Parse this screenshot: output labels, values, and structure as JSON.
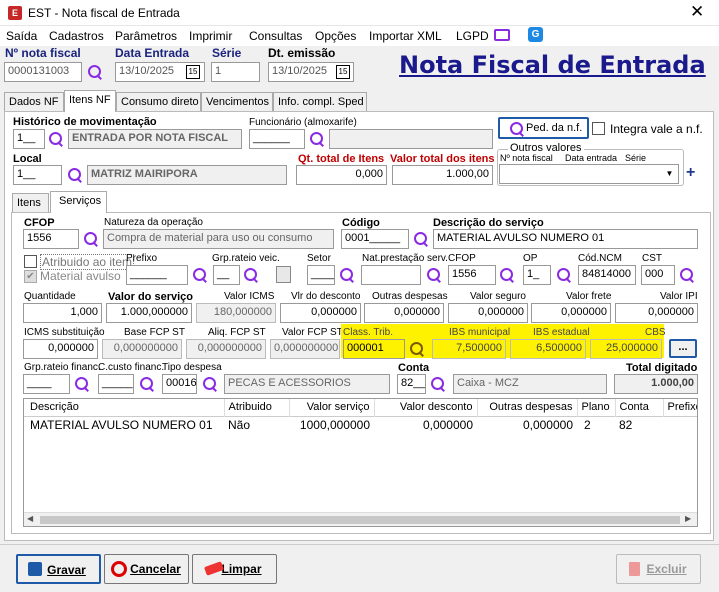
{
  "window": {
    "title": "EST - Nota fiscal de Entrada",
    "close": "✕"
  },
  "menu": [
    "Saída",
    "Cadastros",
    "Parâmetros",
    "Imprimir",
    "Consultas",
    "Opções",
    "Importar XML",
    "LGPD"
  ],
  "header": {
    "nota_label": "Nº nota fiscal",
    "nota_value": "0000131003",
    "data_entrada_label": "Data Entrada",
    "data_entrada_value": "13/10/2025",
    "serie_label": "Série",
    "serie_value": "1",
    "dt_emissao_label": "Dt. emissão",
    "dt_emissao_value": "13/10/2025",
    "calendar_icon": "15",
    "big_title": "Nota Fiscal de Entrada"
  },
  "tabs": [
    "Dados NF",
    "Itens NF",
    "Consumo direto",
    "Vencimentos",
    "Info. compl. Sped"
  ],
  "itens_nf": {
    "historico_label": "Histórico de movimentação",
    "historico_code": "1__",
    "historico_desc": "ENTRADA POR NOTA FISCAL",
    "funcionario_label": "Funcionário (almoxarife)",
    "funcionario_value": "______",
    "ped_button": "Ped. da n.f.",
    "integra_label": "Integra vale a n.f.",
    "local_label": "Local",
    "local_code": "1__",
    "local_desc": "MATRIZ MAIRIPORA",
    "qt_total_label": "Qt. total de Itens",
    "qt_total_value": "0,000",
    "valor_total_label": "Valor total dos itens",
    "valor_total_value": "1.000,00",
    "outros_label": "Outros valores",
    "outros_cols": [
      "Nº nota fiscal",
      "Data entrada",
      "Série"
    ],
    "plus": "+"
  },
  "subtabs": [
    "Itens",
    "Serviços"
  ],
  "servicos": {
    "cfop_label": "CFOP",
    "cfop_value": "1556",
    "natureza_label": "Natureza da operação",
    "natureza_value": "Compra de material para uso ou consumo",
    "codigo_label": "Código",
    "codigo_value": "0001_____",
    "descricao_label": "Descrição do serviço",
    "descricao_value": "MATERIAL AVULSO NUMERO 01",
    "atribuido_label": "Atribuido ao item",
    "material_avulso_label": "Material avulso",
    "prefixo_label": "Prefixo",
    "prefixo_value": "______",
    "grp_rateio_label": "Grp.rateio veic.",
    "grp_rateio_value": "__",
    "setor_label": "Setor",
    "setor_value": "____",
    "nat_prest_label": "Nat.prestação serv.",
    "cfop2_label": "CFOP",
    "cfop2_value": "1556",
    "op_label": "OP",
    "op_value": "1_",
    "ncm_label": "Cód.NCM",
    "ncm_value": "84814000",
    "cst_label": "CST",
    "cst_value": "000",
    "quantidade_label": "Quantidade",
    "quantidade_value": "1,000",
    "valor_servico_label": "Valor do serviço",
    "valor_servico_value": "1.000,000000",
    "valor_icms_label": "Valor ICMS",
    "valor_icms_value": "180,000000",
    "vlr_desconto_label": "Vlr do desconto",
    "vlr_desconto_value": "0,000000",
    "outras_despesas_label": "Outras despesas",
    "outras_despesas_value": "0,000000",
    "valor_seguro_label": "Valor seguro",
    "valor_seguro_value": "0,000000",
    "valor_frete_label": "Valor frete",
    "valor_frete_value": "0,000000",
    "valor_ipi_label": "Valor IPI",
    "valor_ipi_value": "0,000000",
    "icms_subst_label": "ICMS substituição",
    "icms_subst_value": "0,000000",
    "base_fcp_label": "Base FCP ST",
    "base_fcp_value": "0,000000000",
    "aliq_fcp_label": "Aliq. FCP ST",
    "aliq_fcp_value": "0,000000000",
    "valor_fcp_label": "Valor FCP ST",
    "valor_fcp_value": "0,000000000",
    "class_trib_label": "Class. Trib.",
    "class_trib_value": "000001",
    "ibs_mun_label": "IBS municipal",
    "ibs_mun_value": "7,500000",
    "ibs_est_label": "IBS estadual",
    "ibs_est_value": "6,500000",
    "cbs_label": "CBS",
    "cbs_value": "25,000000",
    "dots_button": "...",
    "grp_rateio_fin_label": "Grp.rateio financ.",
    "grp_rateio_fin_value": "____",
    "c_custo_label": "C.custo financ.",
    "c_custo_value": "_____",
    "tipo_despesa_label": "Tipo despesa",
    "tipo_despesa_code": "00016",
    "tipo_despesa_desc": "PECAS E ACESSORIOS",
    "conta_label": "Conta",
    "conta_code": "82__",
    "conta_desc": "Caixa - MCZ",
    "total_digitado_label": "Total digitado",
    "total_digitado_value": "1.000,00"
  },
  "grid": {
    "headers": [
      "Descrição",
      "Atribuido",
      "Valor serviço",
      "Valor desconto",
      "Outras despesas",
      "Plano",
      "Conta",
      "Prefixo"
    ],
    "rows": [
      [
        "MATERIAL AVULSO NUMERO 01",
        "Não",
        "1000,000000",
        "0,000000",
        "0,000000",
        "2",
        "82",
        ""
      ]
    ]
  },
  "footer": {
    "gravar": "Gravar",
    "cancelar": "Cancelar",
    "limpar": "Limpar",
    "excluir": "Excluir"
  }
}
